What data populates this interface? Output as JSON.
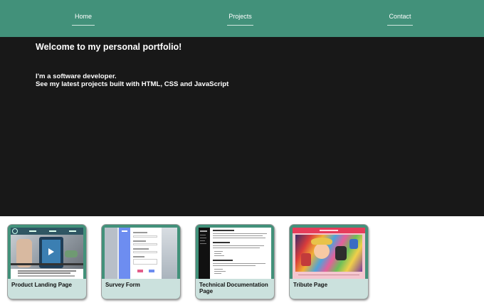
{
  "nav": {
    "home": "Home",
    "projects": "Projects",
    "contact": "Contact"
  },
  "hero": {
    "title": "Welcome to my personal portfolio!",
    "line1": "I'm a software developer.",
    "line2": "See my latest projects built with HTML, CSS and JavaScript"
  },
  "projects": [
    {
      "label": "Product Landing Page"
    },
    {
      "label": "Survey Form"
    },
    {
      "label": "Technical Documentation Page"
    },
    {
      "label": "Tribute Page"
    }
  ],
  "colors": {
    "nav_bg": "#42917a",
    "hero_bg": "#181818",
    "card_label_bg": "#cbe1dd"
  }
}
